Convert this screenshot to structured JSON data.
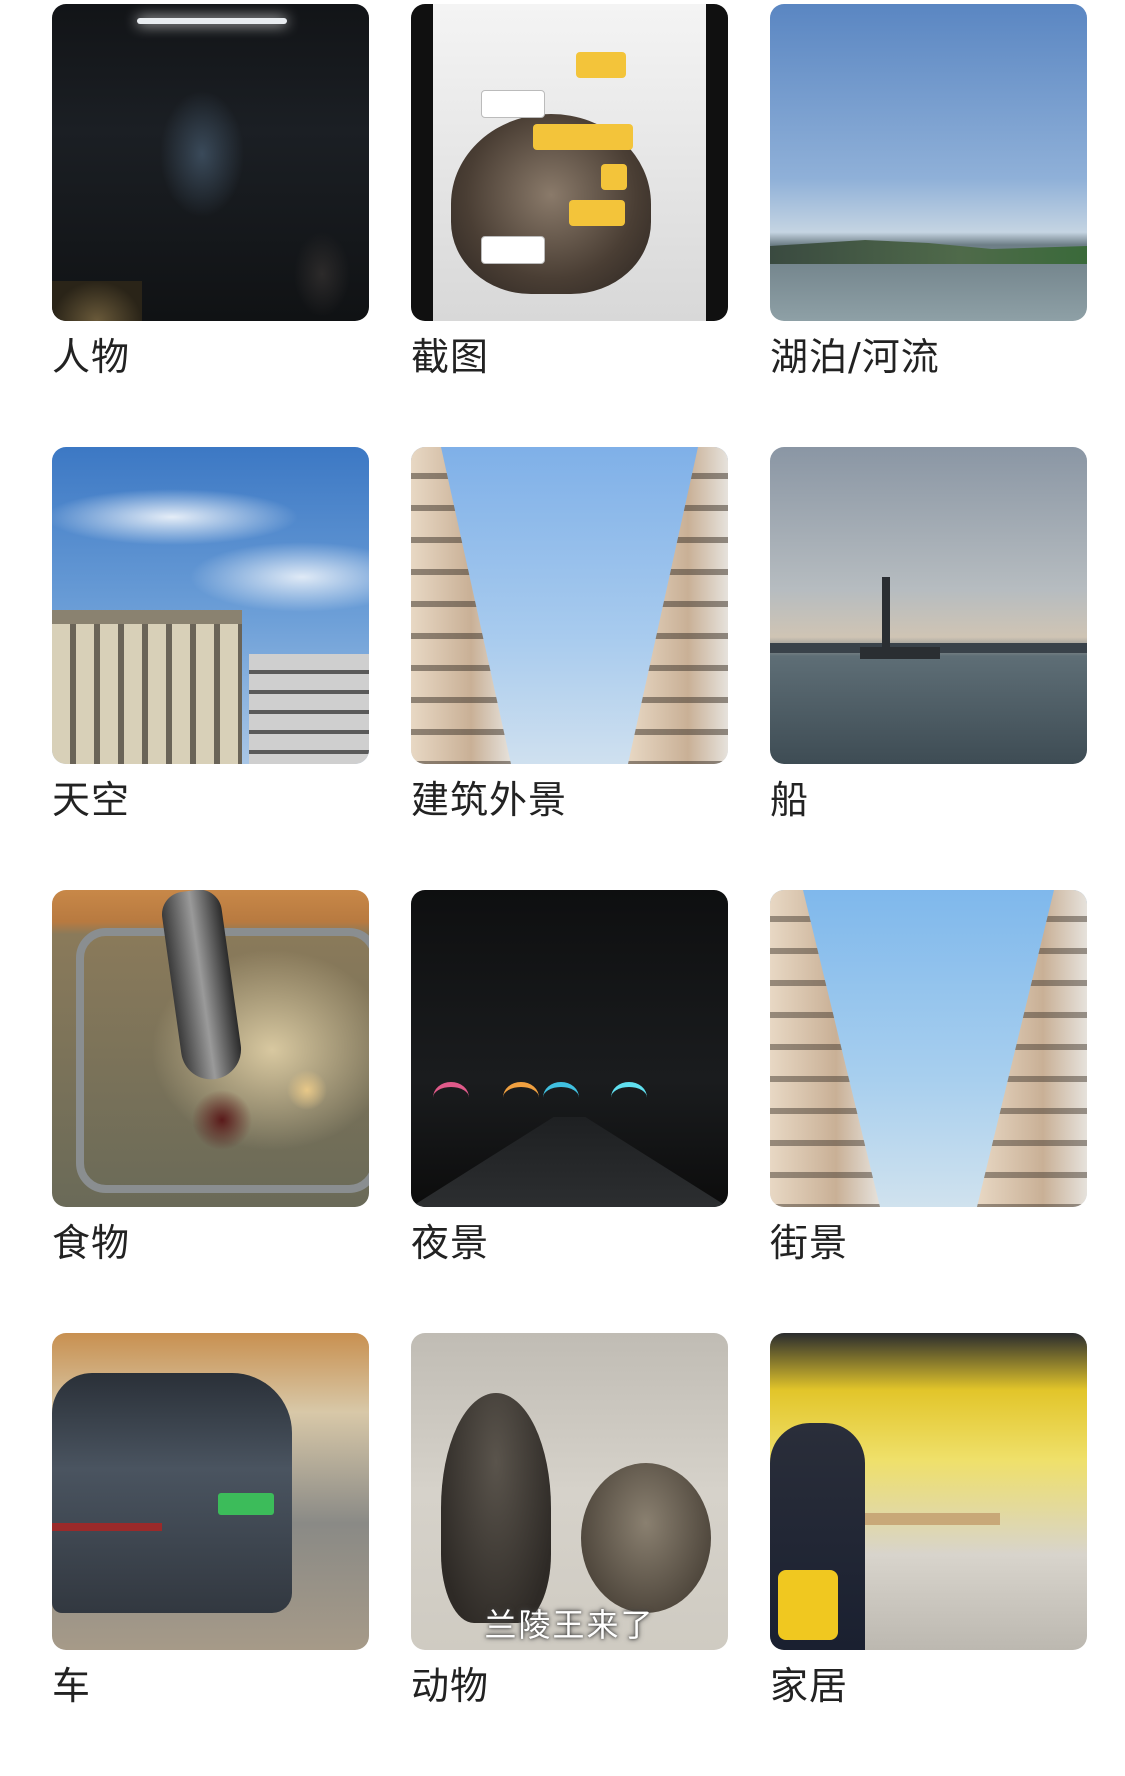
{
  "albums": [
    {
      "label": "人物",
      "thumb": "people-photo"
    },
    {
      "label": "截图",
      "thumb": "screenshot-photo"
    },
    {
      "label": "湖泊/河流",
      "thumb": "lake-river-photo"
    },
    {
      "label": "天空",
      "thumb": "sky-photo"
    },
    {
      "label": "建筑外景",
      "thumb": "building-exterior-photo"
    },
    {
      "label": "船",
      "thumb": "ship-photo"
    },
    {
      "label": "食物",
      "thumb": "food-photo"
    },
    {
      "label": "夜景",
      "thumb": "night-scene-photo"
    },
    {
      "label": "街景",
      "thumb": "street-view-photo"
    },
    {
      "label": "车",
      "thumb": "car-photo"
    },
    {
      "label": "动物",
      "thumb": "animal-photo",
      "caption": "兰陵王来了"
    },
    {
      "label": "家居",
      "thumb": "home-photo"
    }
  ]
}
